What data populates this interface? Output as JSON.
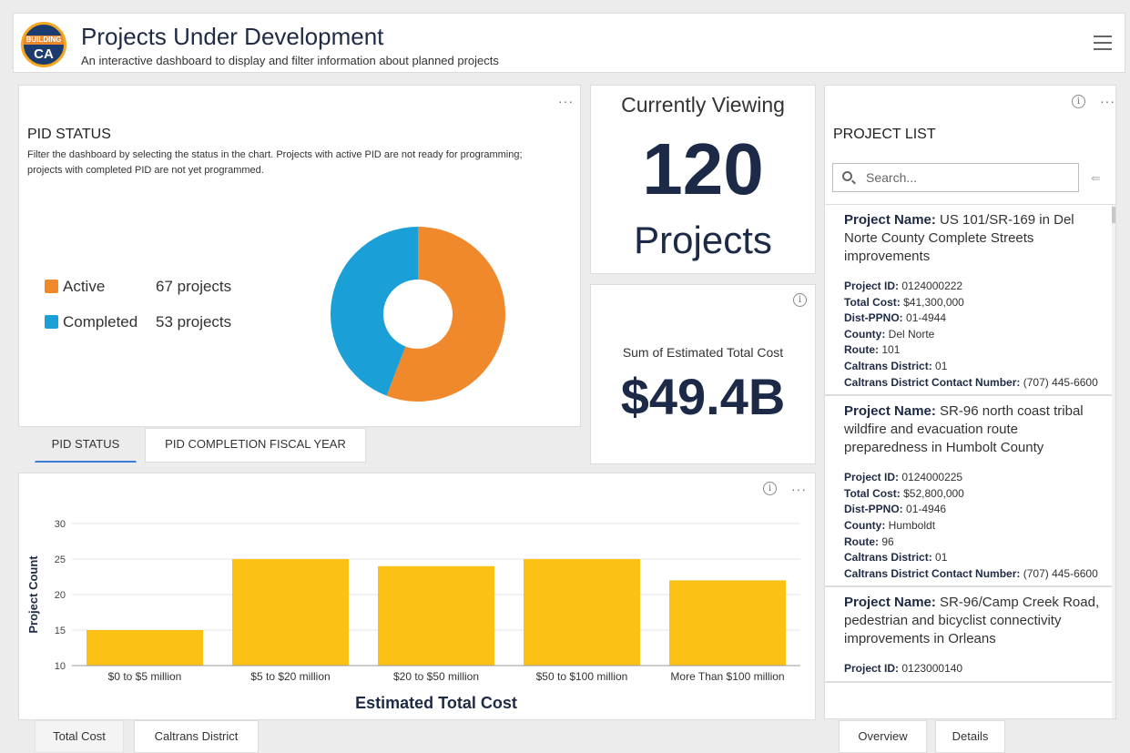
{
  "header": {
    "logo_top_text": "BUILDING",
    "logo_bottom_text": "CA",
    "title": "Projects Under Development",
    "subtitle": "An interactive dashboard to display and filter information about planned projects"
  },
  "pid_status": {
    "title": "PID STATUS",
    "description": "Filter the dashboard by selecting the status in the chart. Projects with active PID are not ready for programming; projects with completed PID are not yet programmed.",
    "legend": [
      {
        "label": "Active",
        "count_text": "67 projects",
        "value": 67,
        "color": "#f0892b"
      },
      {
        "label": "Completed",
        "count_text": "53 projects",
        "value": 53,
        "color": "#1aa0d6"
      }
    ]
  },
  "pid_tabs": [
    "PID STATUS",
    "PID COMPLETION FISCAL YEAR"
  ],
  "currently_viewing": {
    "label": "Currently Viewing",
    "number": "120",
    "unit": "Projects"
  },
  "total_cost": {
    "label": "Sum of Estimated Total Cost",
    "value": "$49.4B"
  },
  "project_list": {
    "title": "PROJECT LIST",
    "search_placeholder": "Search...",
    "field_labels": {
      "name": "Project Name:",
      "id": "Project ID:",
      "cost": "Total Cost:",
      "ppno": "Dist-PPNO:",
      "county": "County:",
      "route": "Route:",
      "district": "Caltrans District:",
      "contact": "Caltrans District Contact Number:"
    },
    "items": [
      {
        "name": "US 101/SR-169 in Del Norte County Complete Streets improvements",
        "id": "0124000222",
        "cost": "$41,300,000",
        "ppno": "01-4944",
        "county": "Del Norte",
        "route": "101",
        "district": "01",
        "contact": "(707) 445-6600"
      },
      {
        "name": "SR-96 north coast tribal wildfire and evacuation route preparedness in Humbolt County",
        "id": "0124000225",
        "cost": "$52,800,000",
        "ppno": "01-4946",
        "county": "Humboldt",
        "route": "96",
        "district": "01",
        "contact": "(707) 445-6600"
      },
      {
        "name": "SR-96/Camp Creek Road, pedestrian and bicyclist connectivity improvements in Orleans",
        "id": "0123000140",
        "cost": "",
        "ppno": "",
        "county": "",
        "route": "",
        "district": "",
        "contact": ""
      }
    ]
  },
  "chart_data": {
    "type": "bar",
    "categories": [
      "$0 to $5 million",
      "$5 to $20 million",
      "$20 to $50 million",
      "$50 to $100 million",
      "More Than $100 million"
    ],
    "values": [
      15,
      25,
      24,
      25,
      22
    ],
    "title": "",
    "xlabel": "Estimated Total Cost",
    "ylabel": "Project Count",
    "ylim": [
      10,
      30
    ],
    "yticks": [
      10,
      15,
      20,
      25,
      30
    ],
    "grid": true,
    "color": "#fbc115"
  },
  "bottom_tabs_left": [
    "Total Cost",
    "Caltrans District"
  ],
  "bottom_tabs_right": [
    "Overview",
    "Details"
  ],
  "icons": {
    "more": "···",
    "info": "i"
  }
}
